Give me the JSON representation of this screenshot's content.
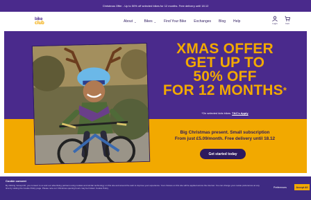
{
  "announcement": "Christmas Offer - Up to 50% off selected bikes for 12 months. Free delivery until 18.12",
  "logo": {
    "line1": "bike",
    "line2": "club"
  },
  "nav": {
    "items": [
      {
        "label": "About",
        "chevron": true
      },
      {
        "label": "Bikes",
        "chevron": true
      },
      {
        "label": "Find Your Bike",
        "chevron": false
      },
      {
        "label": "Exchanges",
        "chevron": false
      },
      {
        "label": "Blog",
        "chevron": false
      },
      {
        "label": "Help",
        "chevron": false
      }
    ],
    "login_label": "Login",
    "cart_label": "Cart"
  },
  "hero": {
    "headline": [
      "XMAS OFFER",
      "GET UP TO",
      "50% OFF",
      "FOR 12 MONTHS"
    ],
    "headline_asterisk": "*",
    "fine_print": "*On selected kids bikes.",
    "fine_link": "T&C's Apply",
    "sub_line1": "Big Christmas present. Small subscription",
    "sub_line2": "From just £5.09/month. Free delivery until 18.12",
    "cta": "Get started today",
    "colors": {
      "purple": "#4a2a8c",
      "orange": "#f2a900",
      "navy": "#2d1a5e"
    }
  },
  "cookie": {
    "title": "Cookie consent",
    "text": "By clicking 'Accept All', you consent to us and our advertising partners using cookies and similar technology on this site and around the web to improve your experience. Your choices on this site will be applied across the internet. You can change your cookie preferences at any time by visiting the Cookie Policy page. Please note our Christmas opening hours may be limited. Cookie Policy",
    "settings_label": "Preferences",
    "accept_label": "Accept All"
  }
}
